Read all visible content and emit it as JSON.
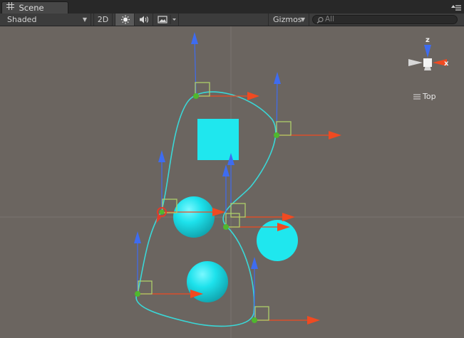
{
  "tab": {
    "title": "Scene",
    "icon": "grid-icon"
  },
  "toolbar": {
    "draw_mode": "Shaded",
    "two_d_label": "2D",
    "gizmos_label": "Gizmos",
    "search_placeholder": "All"
  },
  "gizmo": {
    "axis_z": "z",
    "axis_x": "x",
    "view_label": "Top"
  },
  "colors": {
    "viewport_bg": "#6b6560",
    "spline": "#3ad7d7",
    "object": "#1fe7ee",
    "handle_y": "#3e6cf0",
    "handle_x": "#f04a21",
    "handle_center": "#4fb82d",
    "square_handle": "#aece6a"
  }
}
